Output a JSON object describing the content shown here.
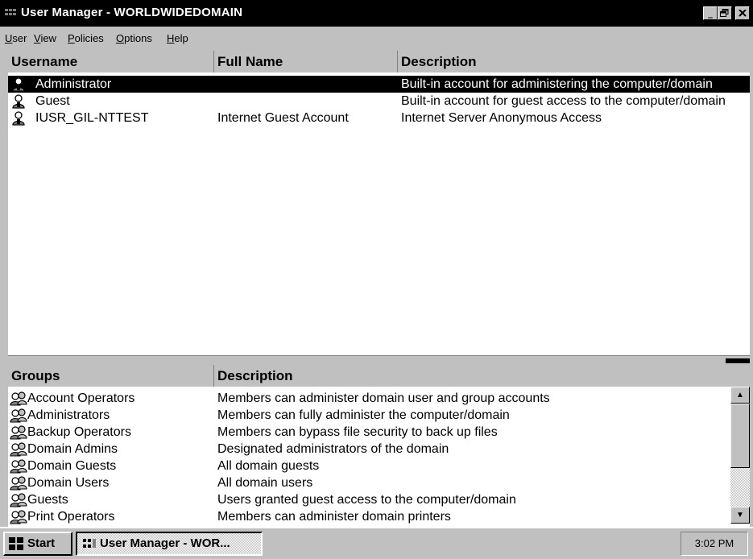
{
  "window": {
    "title": "User Manager - WORLDWIDEDOMAIN",
    "controls": {
      "minimize": "_",
      "restore": "🗗",
      "close": "✕"
    }
  },
  "menu": [
    {
      "label": "User",
      "accel": "U",
      "rest": "ser"
    },
    {
      "label": "View",
      "accel": "V",
      "rest": "iew"
    },
    {
      "label": "Policies",
      "accel": "P",
      "rest": "olicies"
    },
    {
      "label": "Options",
      "accel": "O",
      "rest": "ptions"
    },
    {
      "label": "Help",
      "accel": "H",
      "rest": "elp"
    }
  ],
  "users": {
    "columns": [
      "Username",
      "Full Name",
      "Description"
    ],
    "rows": [
      {
        "username": "Administrator",
        "full_name": "",
        "description": "Built-in account for administering the computer/domain",
        "selected": true,
        "icon": "user-icon"
      },
      {
        "username": "Guest",
        "full_name": "",
        "description": "Built-in account for guest access to the computer/domain",
        "selected": false,
        "icon": "user-icon"
      },
      {
        "username": "IUSR_GIL-NTTEST",
        "full_name": "Internet Guest Account",
        "description": "Internet Server Anonymous Access",
        "selected": false,
        "icon": "user-icon"
      }
    ]
  },
  "groups": {
    "columns": [
      "Groups",
      "Description"
    ],
    "rows": [
      {
        "name": "Account Operators",
        "description": "Members can administer domain user and group accounts",
        "icon": "group-icon"
      },
      {
        "name": "Administrators",
        "description": "Members can fully administer the computer/domain",
        "icon": "group-icon"
      },
      {
        "name": "Backup Operators",
        "description": "Members can bypass file security to back up files",
        "icon": "group-icon"
      },
      {
        "name": "Domain Admins",
        "description": "Designated administrators of the domain",
        "icon": "group-icon"
      },
      {
        "name": "Domain Guests",
        "description": "All domain guests",
        "icon": "group-icon"
      },
      {
        "name": "Domain Users",
        "description": "All domain users",
        "icon": "group-icon"
      },
      {
        "name": "Guests",
        "description": "Users granted guest access to the computer/domain",
        "icon": "group-icon"
      },
      {
        "name": "Print Operators",
        "description": "Members can administer domain printers",
        "icon": "group-icon"
      }
    ]
  },
  "taskbar": {
    "start_label": "Start",
    "task_label": "User Manager - WOR...",
    "clock": "3:02 PM"
  }
}
